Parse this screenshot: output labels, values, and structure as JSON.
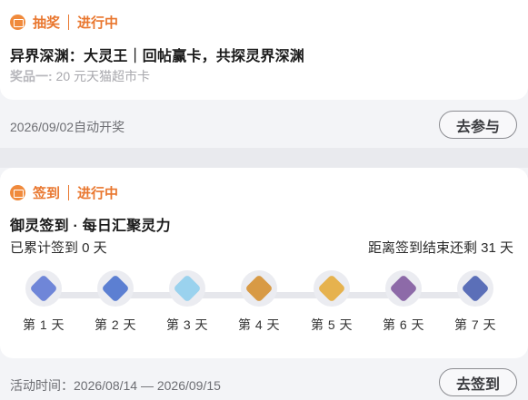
{
  "lottery": {
    "tag": "抽奖",
    "status": "进行中",
    "title": "异界深渊：大灵王｜回帖赢卡，共探灵界深渊",
    "prize_label": "奖品一:",
    "prize_value": " 20 元天猫超市卡",
    "draw_info": "2026/09/02自动开奖",
    "button": "去参与"
  },
  "signin": {
    "tag": "签到",
    "status": "进行中",
    "title": "御灵签到 · 每日汇聚灵力",
    "accumulated": "已累计签到 0 天",
    "remaining": "距离签到结束还剩 31 天",
    "days": [
      {
        "label": "第 1 天",
        "icon": "blue-crystal-icon",
        "color": "#6f86d8"
      },
      {
        "label": "第 2 天",
        "icon": "blue-crystal-icon",
        "color": "#5c7fd2"
      },
      {
        "label": "第 3 天",
        "icon": "ice-crystal-icon",
        "color": "#9ad2ee"
      },
      {
        "label": "第 4 天",
        "icon": "gold-chest-icon",
        "color": "#d89a45"
      },
      {
        "label": "第 5 天",
        "icon": "amber-crystal-icon",
        "color": "#e6b24e"
      },
      {
        "label": "第 6 天",
        "icon": "purple-chest-icon",
        "color": "#8d6aa8"
      },
      {
        "label": "第 7 天",
        "icon": "blue-chest-icon",
        "color": "#5b6fb8"
      }
    ],
    "activity_time": "活动时间：2026/08/14 — 2026/09/15",
    "button": "去签到"
  },
  "colors": {
    "accent": "#e9772f",
    "page_bg": "#e9eaee"
  }
}
